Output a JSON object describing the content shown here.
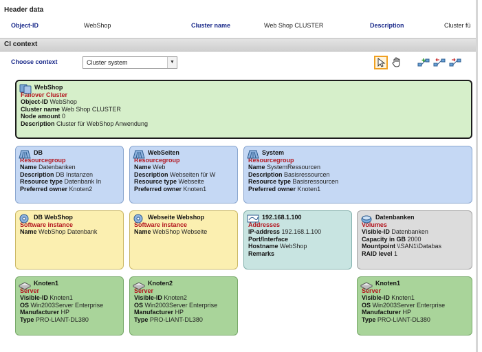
{
  "header": {
    "section_title": "Header data",
    "object_id_label": "Object-ID",
    "object_id_value": "WebShop",
    "cluster_name_label": "Cluster name",
    "cluster_name_value": "Web Shop CLUSTER",
    "description_label": "Description",
    "description_value": "Cluster fü"
  },
  "context": {
    "section_title": "CI context",
    "choose_label": "Choose context",
    "choose_value": "Cluster system"
  },
  "tools": {
    "icons": [
      "pointer-icon",
      "hand-icon",
      "link-add-icon",
      "link-left-icon",
      "link-right-icon"
    ]
  },
  "colors": {
    "label_blue": "#1a2a8a",
    "type_red": "#b3161f",
    "active_tool": "#f0a020"
  },
  "cluster": {
    "title": "WebShop",
    "type": "Failover Cluster",
    "rows": [
      {
        "k": "Object-ID",
        "v": "WebShop"
      },
      {
        "k": "Cluster name",
        "v": "Web Shop CLUSTER"
      },
      {
        "k": "Node amount",
        "v": "0"
      },
      {
        "k": "Description",
        "v": "Cluster für WebShop Anwendung"
      }
    ]
  },
  "resourcegroups": [
    {
      "title": "DB",
      "type": "Resourcegroup",
      "rows": [
        {
          "k": "Name",
          "v": "Datenbanken"
        },
        {
          "k": "Description",
          "v": "DB Instanzen"
        },
        {
          "k": "Resource type",
          "v": "Datenbank In"
        },
        {
          "k": "Preferred owner",
          "v": "Knoten2"
        }
      ]
    },
    {
      "title": "WebSeiten",
      "type": "Resourcegroup",
      "rows": [
        {
          "k": "Name",
          "v": "Web"
        },
        {
          "k": "Description",
          "v": "Webseiten für W"
        },
        {
          "k": "Resource type",
          "v": "Webseite"
        },
        {
          "k": "Preferred owner",
          "v": "Knoten1"
        }
      ]
    },
    {
      "title": "System",
      "type": "Resourcegroup",
      "rows": [
        {
          "k": "Name",
          "v": "SystemRessourcen"
        },
        {
          "k": "Description",
          "v": "Basisressourcen"
        },
        {
          "k": "Resource type",
          "v": "Basisressourcen"
        },
        {
          "k": "Preferred owner",
          "v": "Knoten1"
        }
      ]
    }
  ],
  "instances": [
    {
      "title": "DB WebShop",
      "type": "Software instance",
      "rows": [
        {
          "k": "Name",
          "v": "WebShop Datenbank"
        }
      ]
    },
    {
      "title": "Webseite Webshop",
      "type": "Software instance",
      "rows": [
        {
          "k": "Name",
          "v": "WebShop Webseite"
        }
      ]
    },
    {
      "title": "192.168.1.100",
      "type": "Addresses",
      "rows": [
        {
          "k": "IP-address",
          "v": "192.168.1.100"
        },
        {
          "k": "Port/Interface",
          "v": ""
        },
        {
          "k": "Hostname",
          "v": "WebShop"
        },
        {
          "k": "Remarks",
          "v": ""
        }
      ]
    },
    {
      "title": "Datenbanken",
      "type": "Volumes",
      "rows": [
        {
          "k": "Visible-ID",
          "v": "Datenbanken"
        },
        {
          "k": "Capacity in GB",
          "v": "2000"
        },
        {
          "k": "Mountpoint",
          "v": "\\\\SAN1\\Databas"
        },
        {
          "k": "RAID level",
          "v": "1"
        }
      ]
    }
  ],
  "servers": [
    {
      "title": "Knoten1",
      "type": "Server",
      "rows": [
        {
          "k": "Visible-ID",
          "v": "Knoten1"
        },
        {
          "k": "OS",
          "v": "Win2003Server Enterprise"
        },
        {
          "k": "Manufacturer",
          "v": "HP"
        },
        {
          "k": "Type",
          "v": "PRO-LIANT-DL380"
        }
      ]
    },
    {
      "title": "Knoten2",
      "type": "Server",
      "rows": [
        {
          "k": "Visible-ID",
          "v": "Knoten2"
        },
        {
          "k": "OS",
          "v": "Win2003Server Enterprise"
        },
        {
          "k": "Manufacturer",
          "v": "HP"
        },
        {
          "k": "Type",
          "v": "PRO-LIANT-DL380"
        }
      ]
    },
    {
      "title": "Knoten1",
      "type": "Server",
      "rows": [
        {
          "k": "Visible-ID",
          "v": "Knoten1"
        },
        {
          "k": "OS",
          "v": "Win2003Server Enterprise"
        },
        {
          "k": "Manufacturer",
          "v": "HP"
        },
        {
          "k": "Type",
          "v": "PRO-LIANT-DL380"
        }
      ]
    }
  ]
}
